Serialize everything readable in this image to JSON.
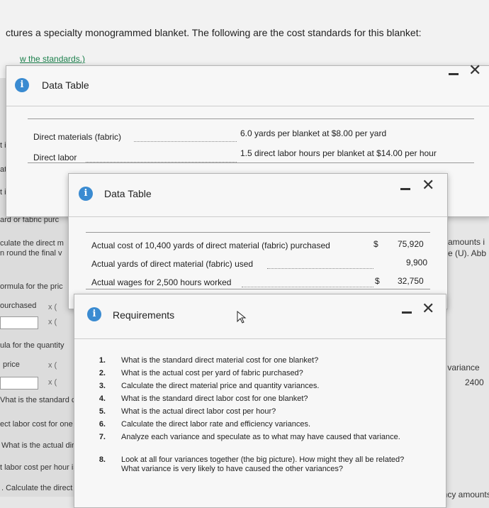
{
  "background": {
    "title": "ctures a specialty monogrammed blanket. The following are the cost standards for this blanket:",
    "link": "w the standards.)",
    "left_texts": [
      "culate the direct m",
      "n round the final v",
      "ormula for the pric",
      "ourchased",
      "ula for the quantity",
      "price",
      "Vhat is the standard c",
      "ect labor cost for one b",
      "What is the actual dire",
      "t labor cost per hour is",
      ". Calculate the direct la",
      "ard or fabric purc",
      "at",
      "t is"
    ],
    "right_texts": [
      "amounts i",
      "e (U). Abb",
      "y variance",
      "2400",
      "rency amounts"
    ],
    "x_marks": [
      "x (",
      "x (",
      "x (",
      "x ("
    ]
  },
  "dialog1": {
    "title": "Data Table",
    "rows": [
      {
        "label": "Direct materials (fabric)",
        "value": "6.0 yards per blanket at $8.00 per yard"
      },
      {
        "label": "Direct labor",
        "value": "1.5 direct labor hours per blanket at $14.00 per hour"
      }
    ]
  },
  "dialog2": {
    "title": "Data Table",
    "rows": [
      {
        "label": "Actual cost of 10,400 yards of direct material (fabric) purchased",
        "currency": "$",
        "value": "75,920"
      },
      {
        "label": "Actual yards of direct material (fabric) used",
        "currency": "",
        "value": "9,900"
      },
      {
        "label": "Actual wages for 2,500 hours worked",
        "currency": "$",
        "value": "32,750"
      }
    ]
  },
  "dialog3": {
    "title": "Requirements",
    "items": [
      {
        "num": "1.",
        "text": "What is the standard direct material cost for one blanket?"
      },
      {
        "num": "2.",
        "text": "What is the actual cost per yard of fabric purchased?"
      },
      {
        "num": "3.",
        "text": "Calculate the direct material price and quantity variances."
      },
      {
        "num": "4.",
        "text": "What is the standard direct labor cost for one blanket?"
      },
      {
        "num": "5.",
        "text": "What is the actual direct labor cost per hour?"
      },
      {
        "num": "6.",
        "text": "Calculate the direct labor rate and efficiency variances."
      },
      {
        "num": "7.",
        "text": "Analyze each variance and speculate as to what may have caused that variance."
      },
      {
        "num": "8.",
        "text": "Look at all four variances together (the big picture). How might they all be related? What variance is very likely to have caused the other variances?"
      }
    ]
  },
  "icons": {
    "info": "info-icon",
    "minimize": "minimize-icon",
    "close": "close-icon",
    "cursor": "mouse-cursor-icon"
  }
}
